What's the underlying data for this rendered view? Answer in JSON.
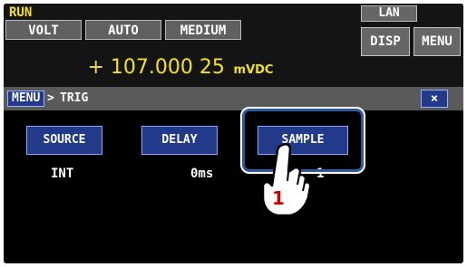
{
  "status": {
    "run": "RUN",
    "lan": "LAN"
  },
  "tabs": {
    "volt": "VOLT",
    "auto": "AUTO",
    "medium": "MEDIUM"
  },
  "top_buttons": {
    "disp": "DISP",
    "menu": "MENU"
  },
  "reading": {
    "value": "+ 107.000 25",
    "unit": "mVDC"
  },
  "breadcrumb": {
    "menu": "MENU",
    "separator": ">",
    "current": "TRIG"
  },
  "close": "×",
  "settings": [
    {
      "label": "SOURCE",
      "value": "INT"
    },
    {
      "label": "DELAY",
      "value": "0ms"
    },
    {
      "label": "SAMPLE",
      "value": "1"
    }
  ],
  "callout": {
    "step": "1"
  },
  "colors": {
    "accent_yellow": "#f4e21a",
    "button_blue": "#233a8b",
    "highlight": "#2c5aa0"
  },
  "icons": {
    "hand": "pointing-hand-icon"
  }
}
